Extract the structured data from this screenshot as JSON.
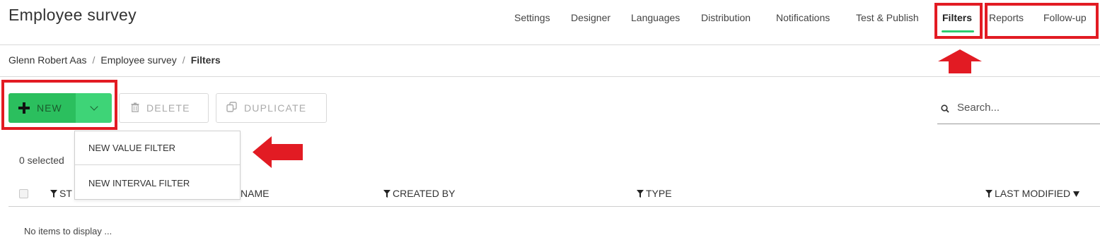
{
  "header": {
    "title": "Employee survey"
  },
  "nav": {
    "items": [
      "Settings",
      "Designer",
      "Languages",
      "Distribution",
      "Notifications",
      "Test & Publish",
      "Filters",
      "Reports",
      "Follow-up"
    ],
    "active": "Filters",
    "accent_color": "#2ecc71"
  },
  "breadcrumb": {
    "items": [
      "Glenn Robert Aas",
      "Employee survey",
      "Filters"
    ],
    "separator": "/"
  },
  "toolbar": {
    "new_label": "NEW",
    "delete_label": "DELETE",
    "duplicate_label": "DUPLICATE",
    "new_color": "#2bbf5e",
    "new_toggle_color": "#3ed477"
  },
  "new_menu": {
    "items": [
      "NEW VALUE FILTER",
      "NEW INTERVAL FILTER"
    ]
  },
  "search": {
    "placeholder": "Search..."
  },
  "table": {
    "selected_text": "0 selected",
    "columns": [
      "STATUS",
      "NAME",
      "CREATED BY",
      "TYPE",
      "LAST MODIFIED"
    ],
    "visible_status_fragment": "ST",
    "sort_column": "LAST MODIFIED",
    "sort_direction": "desc",
    "empty_text": "No items to display ..."
  },
  "annotations": {
    "highlight_color": "#e21b23"
  },
  "icons": {
    "plus": "plus-icon",
    "chevron": "chevron-down-icon",
    "delete": "trash-icon",
    "duplicate": "copy-icon",
    "search": "search-icon",
    "filter": "filter-funnel-icon",
    "sort": "sort-desc-icon"
  }
}
